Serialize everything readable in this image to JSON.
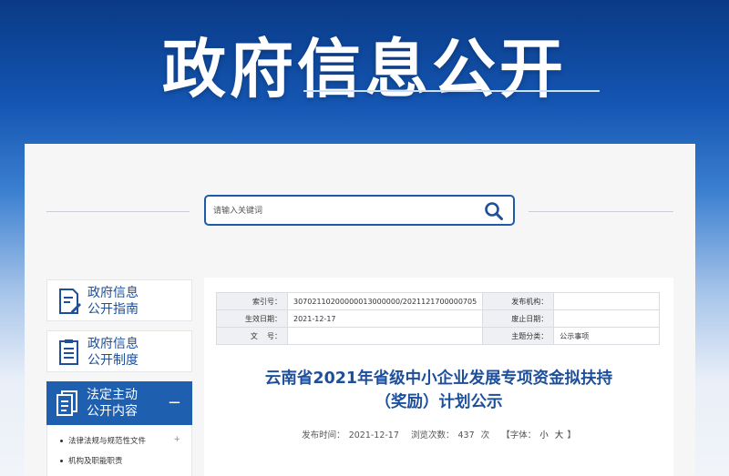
{
  "banner": {
    "title": "政府信息公开"
  },
  "search": {
    "placeholder": "请输入关键词"
  },
  "sidebar": {
    "items": [
      {
        "line1": "政府信息",
        "line2": "公开指南"
      },
      {
        "line1": "政府信息",
        "line2": "公开制度"
      }
    ],
    "active": {
      "line1": "法定主动",
      "line2": "公开内容",
      "toggle": "−"
    },
    "sub_items": [
      {
        "label": "法律法规与规范性文件",
        "expander": "+"
      },
      {
        "label": "机构及职能职责"
      }
    ]
  },
  "meta": {
    "index_label": "索引号：",
    "index_value": "30702110200000013000000/2021121700000705",
    "publisher_label": "发布机构：",
    "publisher_value": "",
    "effective_label": "生效日期：",
    "effective_value": "2021-12-17",
    "expire_label": "废止日期：",
    "expire_value": "",
    "docno_label": "文    号：",
    "docno_value": "",
    "category_label": "主题分类：",
    "category_value": "公示事项"
  },
  "document": {
    "title_line1": "云南省2021年省级中小企业发展专项资金拟扶持",
    "title_line2": "（奖励）计划公示",
    "publish_label": "发布时间：",
    "publish_date": "2021-12-17",
    "views_label": "浏览次数：",
    "views_count": "437",
    "views_unit": "次",
    "font_label": "【字体：",
    "font_small": "小",
    "font_large": "大",
    "font_close": "】"
  }
}
